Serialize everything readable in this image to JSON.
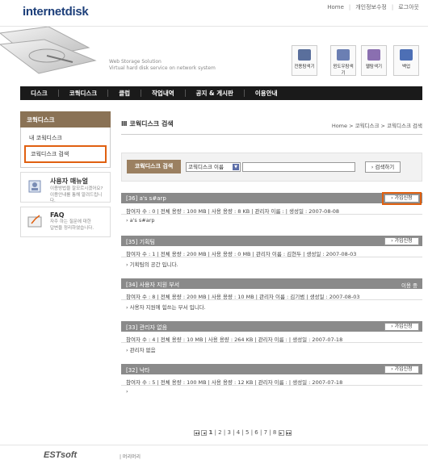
{
  "brand": {
    "logo": "internetdisk"
  },
  "toplinks": [
    "Home",
    "개인정보수정",
    "로그아웃"
  ],
  "slogan": {
    "line1": "Web Storage Solution",
    "line2": "Virtual hard disk service on network system"
  },
  "tools": [
    {
      "label": "전용탐색기",
      "icon": "explorer-icon",
      "color": "#5a6f9c"
    },
    {
      "label": "윈도우탐색기",
      "icon": "window-explorer-icon",
      "color": "#6b7fb3"
    },
    {
      "label": "웹탐색기",
      "icon": "web-explorer-icon",
      "color": "#8a6fb0"
    },
    {
      "label": "백업",
      "icon": "backup-icon",
      "color": "#4d6fb5"
    }
  ],
  "nav": [
    "디스크",
    "코웍디스크",
    "클럽",
    "작업내역",
    "공지 & 게시판",
    "이용안내"
  ],
  "sidebar": {
    "heading": "코웍디스크",
    "items": [
      "내 코웍디스크",
      "코웍디스크 검색"
    ],
    "manual": {
      "title": "사용자 매뉴얼",
      "desc1": "이용방법을 잘모르시겠어요?",
      "desc2": "이용안내를 통해 알려드립니다."
    },
    "faq": {
      "title": "FAQ",
      "desc1": "자주 하는 질문에 대한",
      "desc2": "답변을 정리하였습니다."
    }
  },
  "main": {
    "title": "코웍디스크 검색",
    "breadcrumb": "Home > 코웍디스크 > 코웍디스크 검색",
    "search": {
      "label": "코웍디스크 검색",
      "select": "코웍디스크 이름",
      "button": "› 검색하기"
    }
  },
  "entries": [
    {
      "title": "[36] a's s#arp",
      "action": "› 가입신청",
      "stats": "참여자 수 : 0   |   전체 용량 : 100 MB   |   사용 용량 : 8 KB   |   관리자 이름 :   |   생성일 : 2007-08-08",
      "desc": "› a's s#arp"
    },
    {
      "title": "[35] 기획팀",
      "action": "› 가입신청",
      "stats": "참여자 수 : 1   |   전체 용량 : 200 MB   |   사용 용량 : 0 MB   |   관리자 이름 : 김현두   |   생성일 : 2007-08-03",
      "desc": "› 기획팀의 공간 입니다."
    },
    {
      "title": "[34] 사용자 지원 부서",
      "action": "이용 중",
      "stats": "참여자 수 : 8   |   전체 용량 : 200 MB   |   사용 용량 : 10 MB   |   관리자 이름 : 김기범   |   생성일 : 2007-08-03",
      "desc": "› 사용자 지원에 힘쓰는 부서 입니다."
    },
    {
      "title": "[33] 관리자 없음",
      "action": "› 가입신청",
      "stats": "참여자 수 : 4   |   전체 용량 : 10 MB   |   사용 용량 : 264 KB   |   관리자 이름 :   |   생성일 : 2007-07-18",
      "desc": "› 관리자 없음"
    },
    {
      "title": "[32] 낙타",
      "action": "› 가입신청",
      "stats": "참여자 수 : 5   |   전체 용량 : 100 MB   |   사용 용량 : 12 KB   |   관리자 이름 :   |   생성일 : 2007-07-18",
      "desc": "›"
    }
  ],
  "pager": {
    "pages": [
      "1",
      "2",
      "3",
      "4",
      "5",
      "6",
      "7",
      "8"
    ],
    "current": "1"
  },
  "footer": {
    "logo": "ESTsoft",
    "copy": "| 머리머리"
  }
}
